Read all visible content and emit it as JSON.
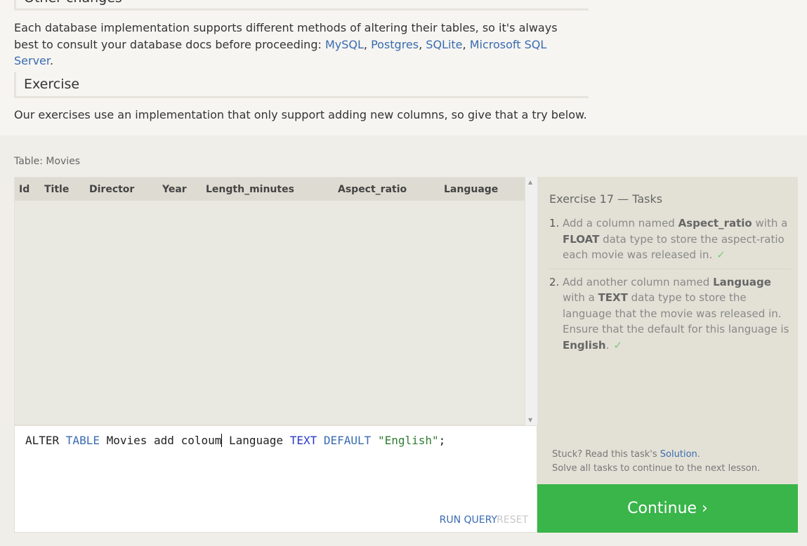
{
  "lesson": {
    "prev_heading": "Other changes",
    "paragraph1_text": "Each database implementation supports different methods of altering their tables, so it's always best to consult your database docs before proceeding: ",
    "links": [
      "MySQL",
      "Postgres",
      "SQLite",
      "Microsoft SQL Server"
    ],
    "sep": ", ",
    "period": ".",
    "exercise_heading": "Exercise",
    "paragraph2": "Our exercises use an implementation that only support adding new columns, so give that a try below."
  },
  "table": {
    "label": "Table: Movies",
    "columns": [
      "Id",
      "Title",
      "Director",
      "Year",
      "Length_minutes",
      "Aspect_ratio",
      "Language"
    ]
  },
  "editor": {
    "tokens": {
      "t1": "ALTER ",
      "t2": "TABLE",
      "t3": " Movies add coloum",
      "t4": " Language ",
      "t5": "TEXT",
      "t6": " ",
      "t7": "DEFAULT",
      "t8": " ",
      "t9": "\"English\"",
      "t10": ";"
    },
    "run_label": "RUN QUERY",
    "reset_label": "RESET"
  },
  "tasks": {
    "title": "Exercise 17 — Tasks",
    "items": [
      {
        "num": "1.",
        "p1": "Add a column named ",
        "b1": "Aspect_ratio",
        "p2": " with a ",
        "b2": "FLOAT",
        "p3": " data type to store the aspect-ratio each movie was released in.",
        "check": "✓"
      },
      {
        "num": "2.",
        "p1": "Add another column named ",
        "b1": "Language",
        "p2": " with a ",
        "b2": "TEXT",
        "p3": " data type to store the language that the movie was released in. Ensure that the default for this language is ",
        "b3": "English",
        "p4": ".",
        "check": "✓"
      }
    ],
    "stuck_prefix": "Stuck? Read this task's ",
    "solution_label": "Solution",
    "stuck_suffix": ".",
    "solve_all": "Solve all tasks to continue to the next lesson."
  },
  "continue_label": "Continue ›",
  "colors": {
    "link": "#3a6bb0",
    "continue_bg": "#39b54a",
    "check": "#7cc87a"
  }
}
